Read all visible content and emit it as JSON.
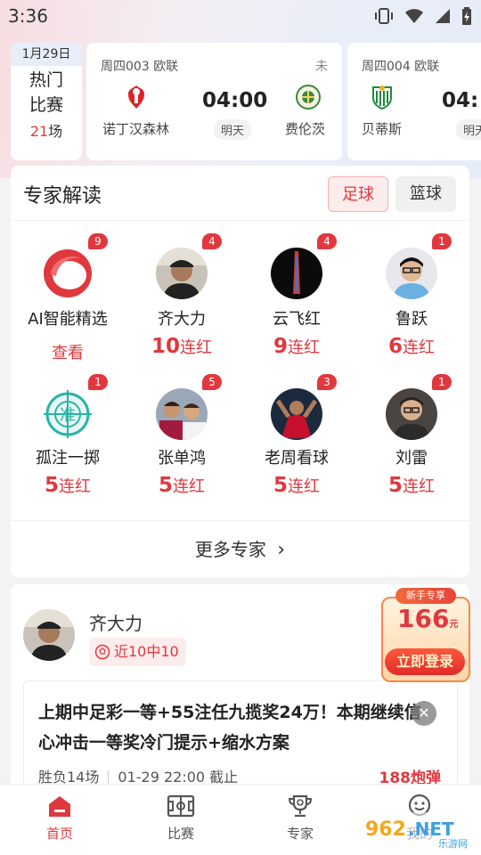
{
  "status_bar": {
    "time": "3:36"
  },
  "hot": {
    "date": "1月29日",
    "title_1": "热门",
    "title_2": "比赛",
    "count": "21",
    "count_unit": "场"
  },
  "matches": [
    {
      "code": "周四003",
      "league": "欧联",
      "state": "未",
      "home": "诺丁汉森林",
      "away": "费伦茨",
      "time": "04:00",
      "day": "明天"
    },
    {
      "code": "周四004",
      "league": "欧联",
      "home": "贝蒂斯",
      "time": "04:",
      "day": "明天"
    }
  ],
  "expert": {
    "title": "专家解读",
    "tabs": [
      "足球",
      "篮球"
    ],
    "items": [
      {
        "name": "AI智能精选",
        "badge": "9",
        "sub": "查看",
        "num": "",
        "icon": "ai-logo-icon"
      },
      {
        "name": "齐大力",
        "badge": "4",
        "num": "10",
        "sub": "连红",
        "icon": "avatar-icon"
      },
      {
        "name": "云飞红",
        "badge": "4",
        "num": "9",
        "sub": "连红",
        "icon": "avatar-icon"
      },
      {
        "name": "鲁跃",
        "badge": "1",
        "num": "6",
        "sub": "连红",
        "icon": "avatar-icon"
      },
      {
        "name": "孤注一掷",
        "badge": "1",
        "num": "5",
        "sub": "连红",
        "icon": "target-icon"
      },
      {
        "name": "张单鸿",
        "badge": "5",
        "num": "5",
        "sub": "连红",
        "icon": "avatar-icon"
      },
      {
        "name": "老周看球",
        "badge": "3",
        "num": "5",
        "sub": "连红",
        "icon": "avatar-icon"
      },
      {
        "name": "刘雷",
        "badge": "1",
        "num": "5",
        "sub": "连红",
        "icon": "avatar-icon"
      }
    ],
    "more": "更多专家",
    "more_arrow": "›"
  },
  "article": {
    "author": "齐大力",
    "tag": "近10中10",
    "title": "上期中足彩一等+55注任九揽奖24万！本期继续信心冲击一等奖冷门提示+缩水方案",
    "meta_1": "胜负14场",
    "meta_2": "01-29 22:00 截止",
    "price": "188炮弹"
  },
  "promo": {
    "top": "新手专享",
    "amount": "166",
    "unit": "元",
    "button": "立即登录",
    "close": "✕"
  },
  "tabbar": {
    "items": [
      "首页",
      "比赛",
      "专家",
      "我的"
    ]
  },
  "watermark": {
    "text": "962.NET",
    "sub": "乐游网"
  },
  "colors": {
    "accent": "#e0383e",
    "background": "#f3f3f3"
  }
}
